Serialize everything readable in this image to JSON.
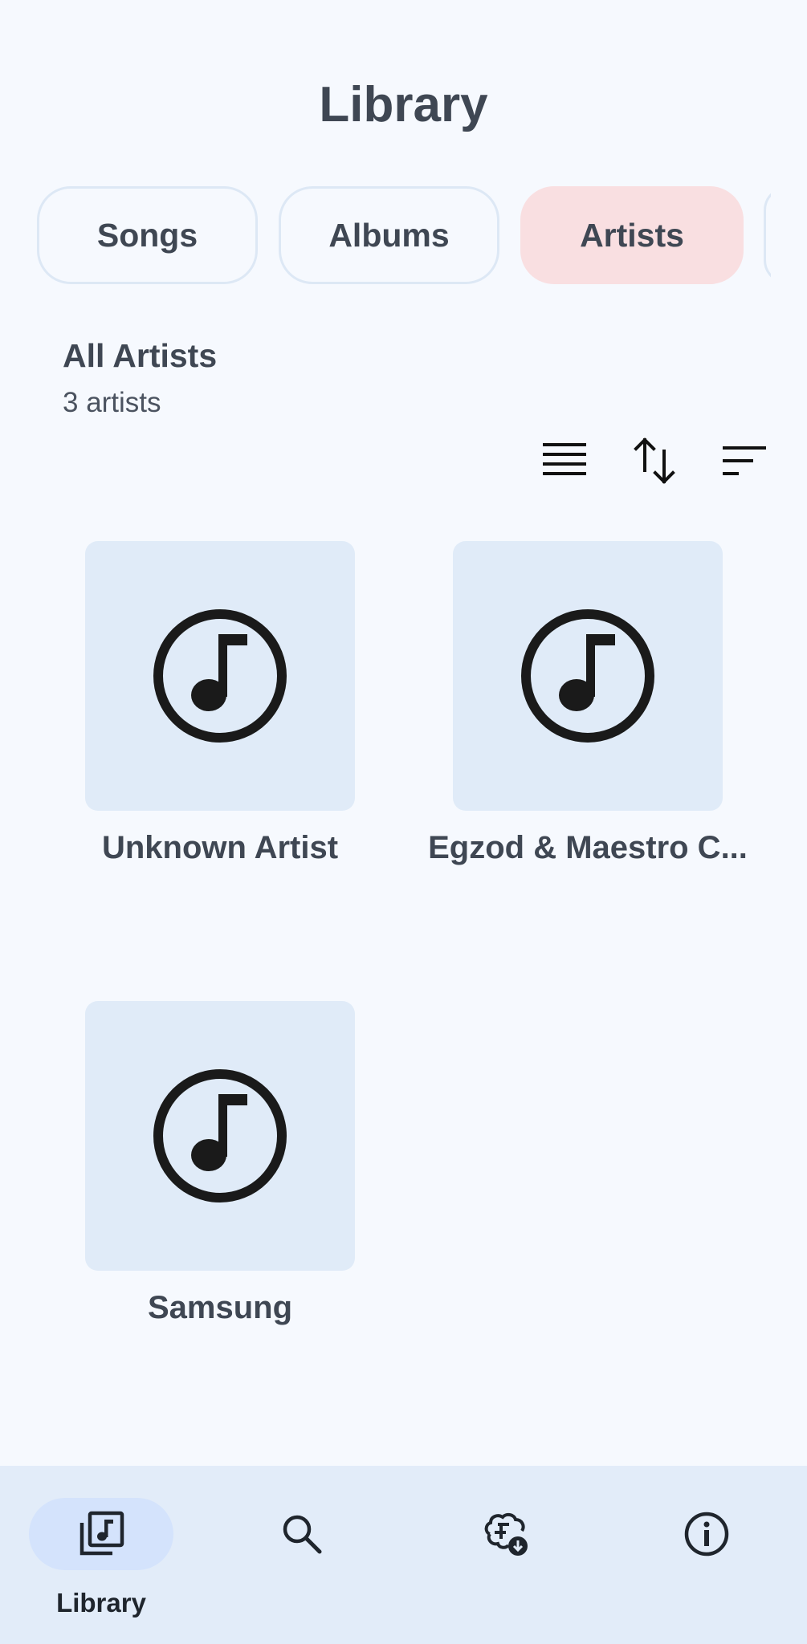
{
  "header": {
    "title": "Library"
  },
  "tabs": [
    {
      "label": "Songs",
      "active": false
    },
    {
      "label": "Albums",
      "active": false
    },
    {
      "label": "Artists",
      "active": true
    }
  ],
  "section": {
    "title": "All Artists",
    "subtitle": "3 artists"
  },
  "toolbar": {
    "icons": [
      "list-view-icon",
      "sort-order-icon",
      "filter-sort-icon"
    ]
  },
  "artists": [
    {
      "name": "Unknown Artist",
      "icon": "music-note-icon"
    },
    {
      "name": "Egzod & Maestro C...",
      "icon": "music-note-icon"
    },
    {
      "name": "Samsung",
      "icon": "music-note-icon"
    }
  ],
  "bottom_nav": {
    "items": [
      {
        "label": "Library",
        "icon": "library-music-icon",
        "active": true
      },
      {
        "label": "",
        "icon": "search-icon",
        "active": false
      },
      {
        "label": "",
        "icon": "ai-download-icon",
        "active": false
      },
      {
        "label": "",
        "icon": "info-icon",
        "active": false
      }
    ]
  },
  "colors": {
    "background": "#f6f9fe",
    "active_tab": "#f9dfe1",
    "card_bg": "#e0ebf8",
    "nav_bg": "#e2ecf9",
    "nav_active": "#d4e3fc",
    "text": "#3f4753"
  }
}
